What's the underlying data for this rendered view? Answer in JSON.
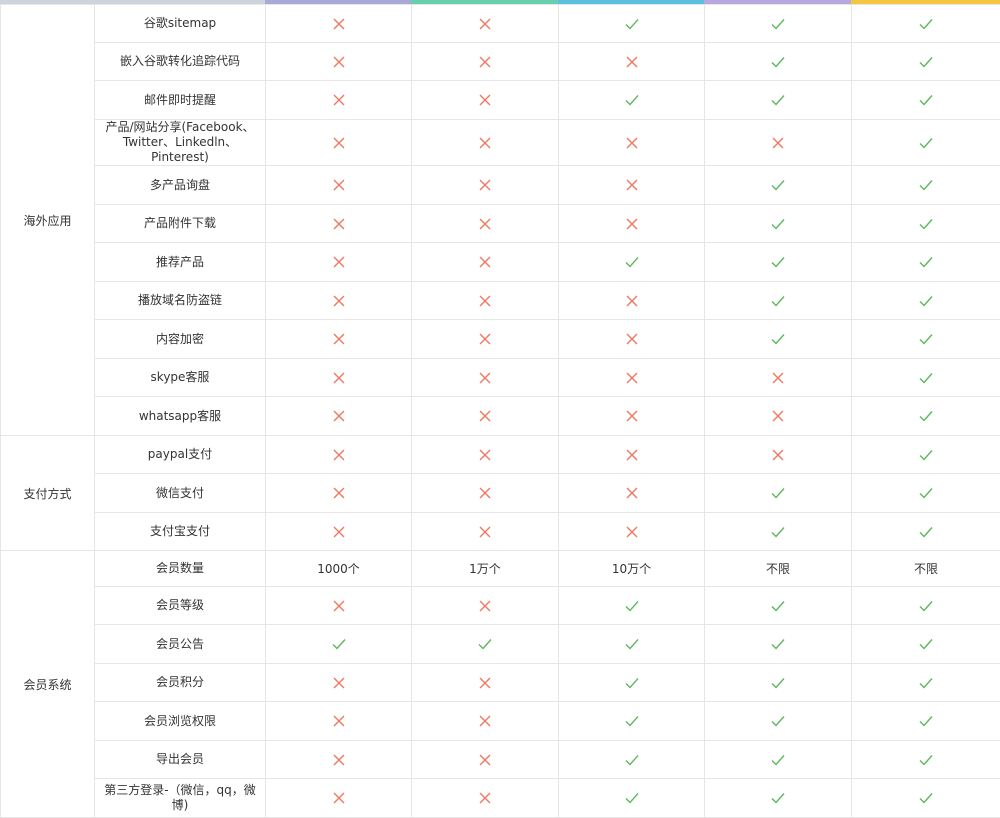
{
  "colors": {
    "check": "#5cb85c",
    "cross": "#f0775f",
    "border": "#e6e6e6",
    "text": "#333333",
    "strip": [
      "#cfd4dc",
      "#a9a8d8",
      "#66cfae",
      "#5bc0de",
      "#b9a7e0",
      "#f5c542"
    ]
  },
  "icons": {
    "yes": "check-icon",
    "no": "cross-icon"
  },
  "groups": [
    {
      "label": "海外应用",
      "rows": [
        {
          "feature": "谷歌sitemap",
          "cells": [
            "no",
            "no",
            "yes",
            "yes",
            "yes"
          ]
        },
        {
          "feature": "嵌入谷歌转化追踪代码",
          "cells": [
            "no",
            "no",
            "no",
            "yes",
            "yes"
          ]
        },
        {
          "feature": "邮件即时提醒",
          "cells": [
            "no",
            "no",
            "yes",
            "yes",
            "yes"
          ]
        },
        {
          "feature": "产品/网站分享(Facebook、Twitter、Linkedln、Pinterest)",
          "cells": [
            "no",
            "no",
            "no",
            "no",
            "yes"
          ]
        },
        {
          "feature": "多产品询盘",
          "cells": [
            "no",
            "no",
            "no",
            "yes",
            "yes"
          ]
        },
        {
          "feature": "产品附件下载",
          "cells": [
            "no",
            "no",
            "no",
            "yes",
            "yes"
          ]
        },
        {
          "feature": "推荐产品",
          "cells": [
            "no",
            "no",
            "yes",
            "yes",
            "yes"
          ]
        },
        {
          "feature": "播放域名防盗链",
          "cells": [
            "no",
            "no",
            "no",
            "yes",
            "yes"
          ]
        },
        {
          "feature": "内容加密",
          "cells": [
            "no",
            "no",
            "no",
            "yes",
            "yes"
          ]
        },
        {
          "feature": "skype客服",
          "cells": [
            "no",
            "no",
            "no",
            "no",
            "yes"
          ]
        },
        {
          "feature": "whatsapp客服",
          "cells": [
            "no",
            "no",
            "no",
            "no",
            "yes"
          ]
        }
      ]
    },
    {
      "label": "支付方式",
      "rows": [
        {
          "feature": "paypal支付",
          "cells": [
            "no",
            "no",
            "no",
            "no",
            "yes"
          ]
        },
        {
          "feature": "微信支付",
          "cells": [
            "no",
            "no",
            "no",
            "yes",
            "yes"
          ]
        },
        {
          "feature": "支付宝支付",
          "cells": [
            "no",
            "no",
            "no",
            "yes",
            "yes"
          ]
        }
      ]
    },
    {
      "label": "会员系统",
      "rows": [
        {
          "feature": "会员数量",
          "cells": [
            "1000个",
            "1万个",
            "10万个",
            "不限",
            "不限"
          ]
        },
        {
          "feature": "会员等级",
          "cells": [
            "no",
            "no",
            "yes",
            "yes",
            "yes"
          ]
        },
        {
          "feature": "会员公告",
          "cells": [
            "yes",
            "yes",
            "yes",
            "yes",
            "yes"
          ]
        },
        {
          "feature": "会员积分",
          "cells": [
            "no",
            "no",
            "yes",
            "yes",
            "yes"
          ]
        },
        {
          "feature": "会员浏览权限",
          "cells": [
            "no",
            "no",
            "yes",
            "yes",
            "yes"
          ]
        },
        {
          "feature": "导出会员",
          "cells": [
            "no",
            "no",
            "yes",
            "yes",
            "yes"
          ]
        },
        {
          "feature": "第三方登录-（微信，qq，微博)",
          "cells": [
            "no",
            "no",
            "yes",
            "yes",
            "yes"
          ]
        }
      ]
    }
  ]
}
